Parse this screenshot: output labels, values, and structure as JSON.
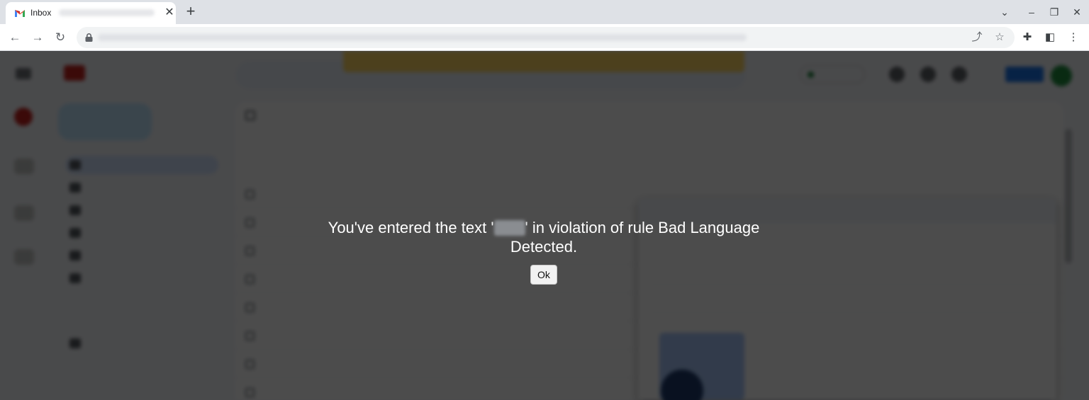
{
  "browser": {
    "tab_title": "Inbox",
    "tab_close": "✕",
    "new_tab": "+",
    "window_controls": [
      "⌄",
      "–",
      "❐",
      "✕"
    ],
    "nav_back": "←",
    "nav_forward": "→",
    "nav_reload": "↻",
    "omnibox_actions": [
      "⤴",
      "☆"
    ],
    "toolbar_icons": [
      "extensions-icon",
      "side-panel-icon",
      "menu-icon"
    ],
    "toolbar_glyphs": [
      "✚",
      "◧",
      "⋮"
    ]
  },
  "dialog": {
    "message_prefix": "You've entered the text '",
    "message_suffix": "' in violation of rule Bad Language Detected.",
    "ok_label": "Ok"
  },
  "colors": {
    "overlay": "#000000b3",
    "dialog_text": "#ffffff",
    "ok_button_bg": "#f2f2f2"
  }
}
